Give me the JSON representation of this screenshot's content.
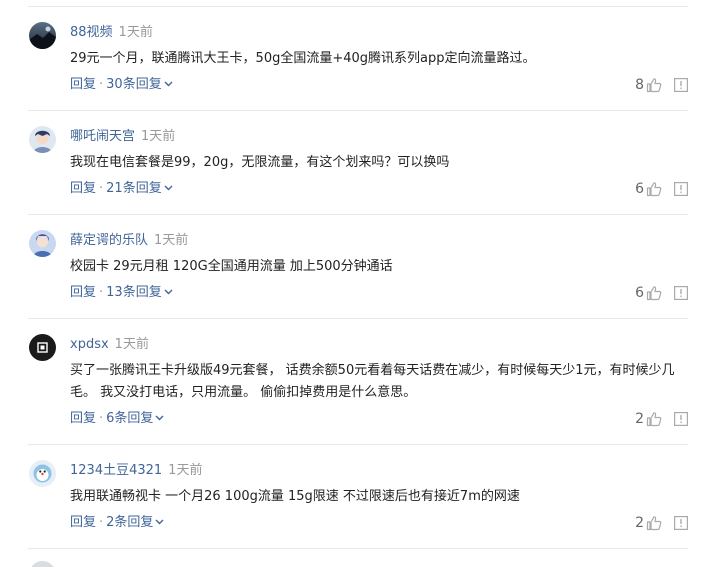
{
  "comments": [
    {
      "username": "88视频",
      "time": "1天前",
      "text": "29元一个月，联通腾讯大王卡，50g全国流量+40g腾讯系列app定向流量路过。",
      "reply_label": "回复",
      "dot": "·",
      "replies_label": "30条回复",
      "likes": "8",
      "avatar_icon": "dark-landscape-avatar"
    },
    {
      "username": "哪吒闹天宫",
      "time": "1天前",
      "text": "我现在电信套餐是99，20g，无限流量，有这个划来吗？可以换吗",
      "reply_label": "回复",
      "dot": "·",
      "replies_label": "21条回复",
      "likes": "6",
      "avatar_icon": "anime-character-avatar"
    },
    {
      "username": "薛定谔的乐队",
      "time": "1天前",
      "text": "校园卡 29元月租 120G全国通用流量 加上500分钟通话",
      "reply_label": "回复",
      "dot": "·",
      "replies_label": "13条回复",
      "likes": "6",
      "avatar_icon": "anime-character-avatar"
    },
    {
      "username": "xpdsx",
      "time": "1天前",
      "text": "买了一张腾讯王卡升级版49元套餐， 话费余额50元看着每天话费在减少，有时候每天少1元，有时候少几毛。 我又没打电话，只用流量。 偷偷扣掉费用是什么意思。",
      "reply_label": "回复",
      "dot": "·",
      "replies_label": "6条回复",
      "likes": "2",
      "avatar_icon": "dark-logo-avatar"
    },
    {
      "username": "1234土豆4321",
      "time": "1天前",
      "text": "我用联通畅视卡 一个月26 100g流量 15g限速 不过限速后也有接近7m的网速",
      "reply_label": "回复",
      "dot": "·",
      "replies_label": "2条回复",
      "likes": "2",
      "avatar_icon": "cartoon-avatar"
    }
  ],
  "colors": {
    "username": "#406599",
    "link": "#406599",
    "time": "#999999",
    "text": "#222222",
    "icon": "#aaaaaa",
    "divider": "#e8e8e8"
  }
}
